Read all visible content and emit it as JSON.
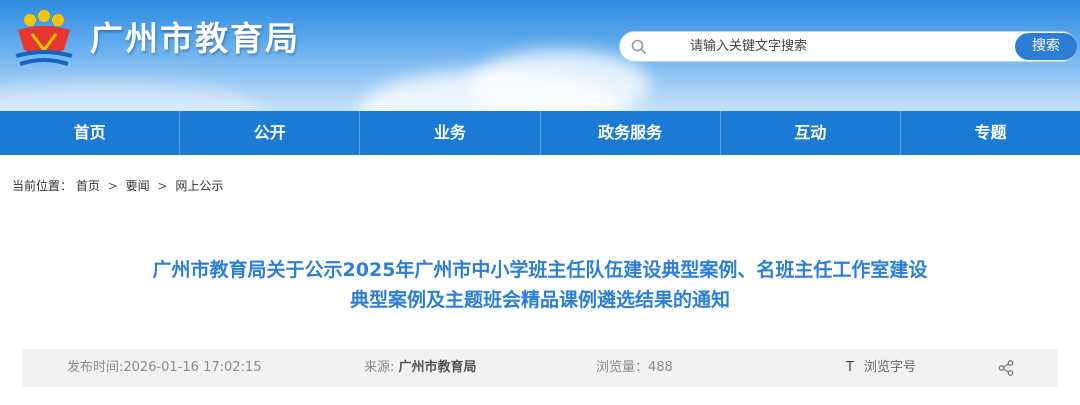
{
  "site": {
    "title": "广州市教育局",
    "colors": {
      "header_top": "#2f8be0",
      "nav_bg": "#1a7ad4",
      "title_text": "#2c7fd6",
      "meta_bg": "#f2f2f2"
    }
  },
  "search": {
    "placeholder": "请输入关键文字搜索",
    "button_label": "搜索",
    "icon": "search-icon"
  },
  "nav": {
    "items": [
      "首页",
      "公开",
      "业务",
      "政务服务",
      "互动",
      "专题"
    ]
  },
  "breadcrumb": {
    "prefix": "当前位置：",
    "items": [
      "首页",
      "要闻",
      "网上公示"
    ],
    "separator": ">"
  },
  "article": {
    "title_line1": "广州市教育局关于公示2025年广州市中小学班主任队伍建设典型案例、名班主任工作室建设",
    "title_line2": "典型案例及主题班会精品课例遴选结果的通知"
  },
  "meta": {
    "publish_label": "发布时间:",
    "publish_time": "2026-01-16 17:02:15",
    "source_label": "来源: ",
    "source_value": "广州市教育局",
    "views_label": "浏览量：",
    "views_value": "488",
    "font_icon": "T",
    "font_label": "浏览字号",
    "share_icon": "share-icon"
  }
}
